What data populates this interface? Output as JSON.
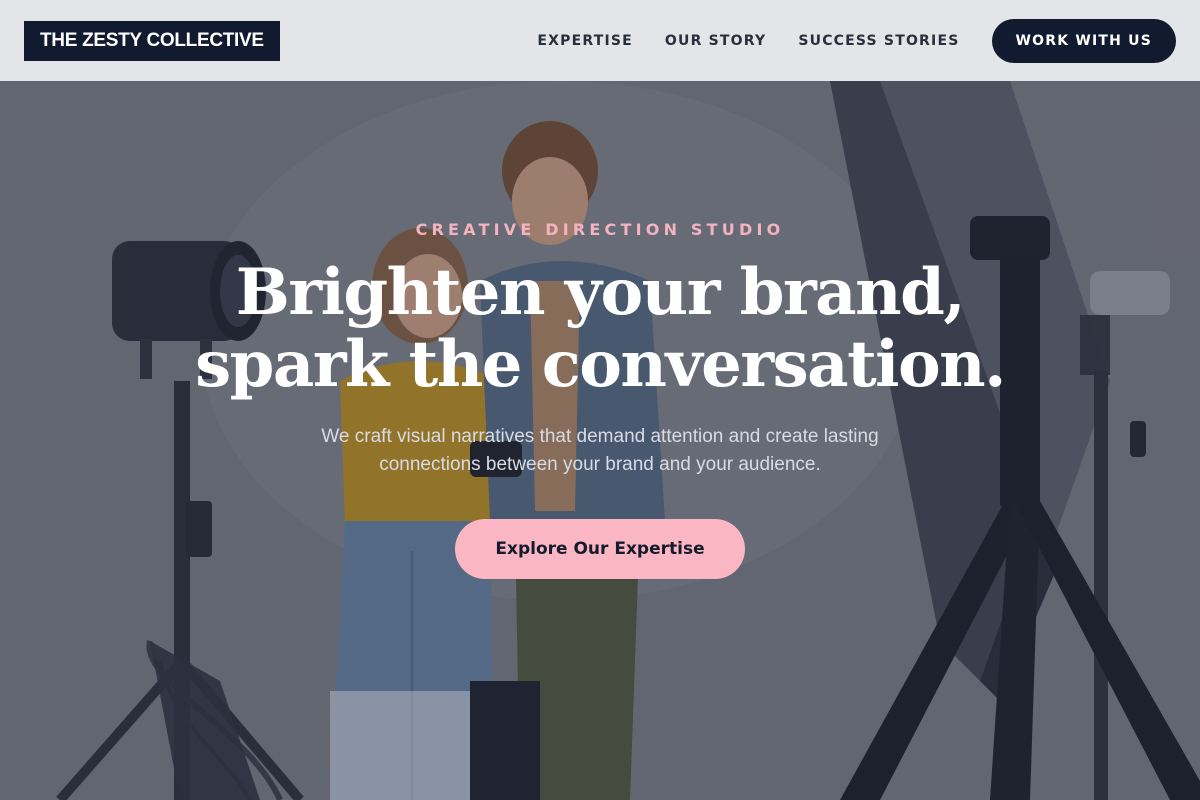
{
  "header": {
    "logo": "THE ZESTY COLLECTIVE",
    "nav": [
      {
        "label": "EXPERTISE"
      },
      {
        "label": "OUR STORY"
      },
      {
        "label": "SUCCESS STORIES"
      }
    ],
    "cta_label": "WORK WITH US"
  },
  "hero": {
    "eyebrow": "CREATIVE DIRECTION STUDIO",
    "headline_line1": "Brighten your brand,",
    "headline_line2": "spark the conversation.",
    "subtext": "We craft visual narratives that demand attention and create lasting connections between your brand and your audience.",
    "cta_label": "Explore Our Expertise",
    "background_image": "photo-studio-scene-with-two-people-and-lighting-equipment"
  },
  "colors": {
    "dark_navy": "#111a2e",
    "header_bg": "#e4e5e8",
    "accent_pink": "#fbb6c3",
    "eyebrow_pink": "#f3b3bf"
  }
}
